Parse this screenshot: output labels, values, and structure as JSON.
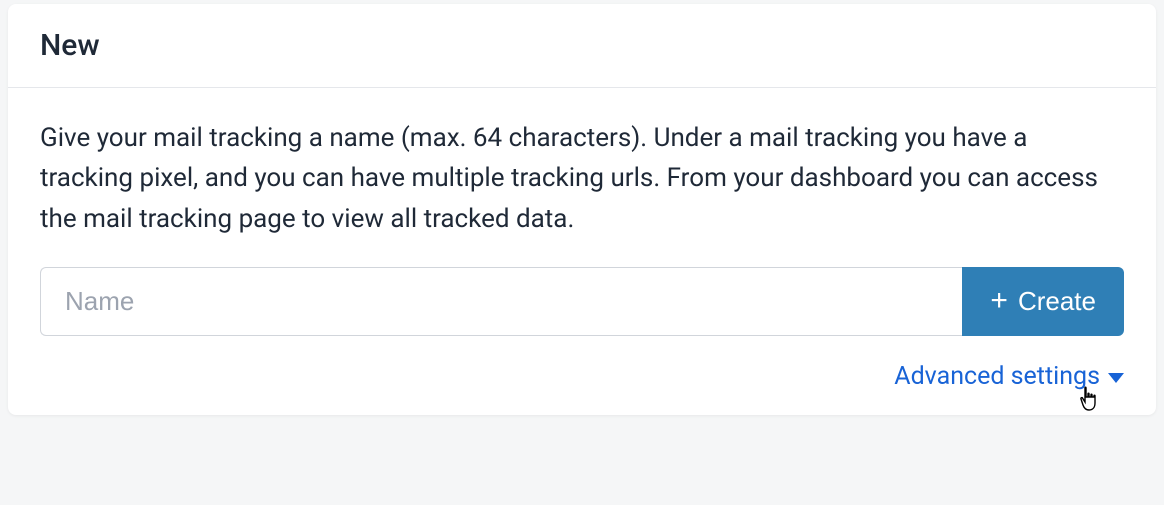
{
  "header": {
    "title": "New"
  },
  "body": {
    "description": "Give your mail tracking a name (max. 64 characters). Under a mail tracking you have a tracking pixel, and you can have multiple tracking urls. From your dashboard you can access the mail tracking page to view all tracked data.",
    "name_input": {
      "placeholder": "Name",
      "value": ""
    },
    "create_button_label": "Create",
    "advanced_settings_label": "Advanced settings"
  }
}
